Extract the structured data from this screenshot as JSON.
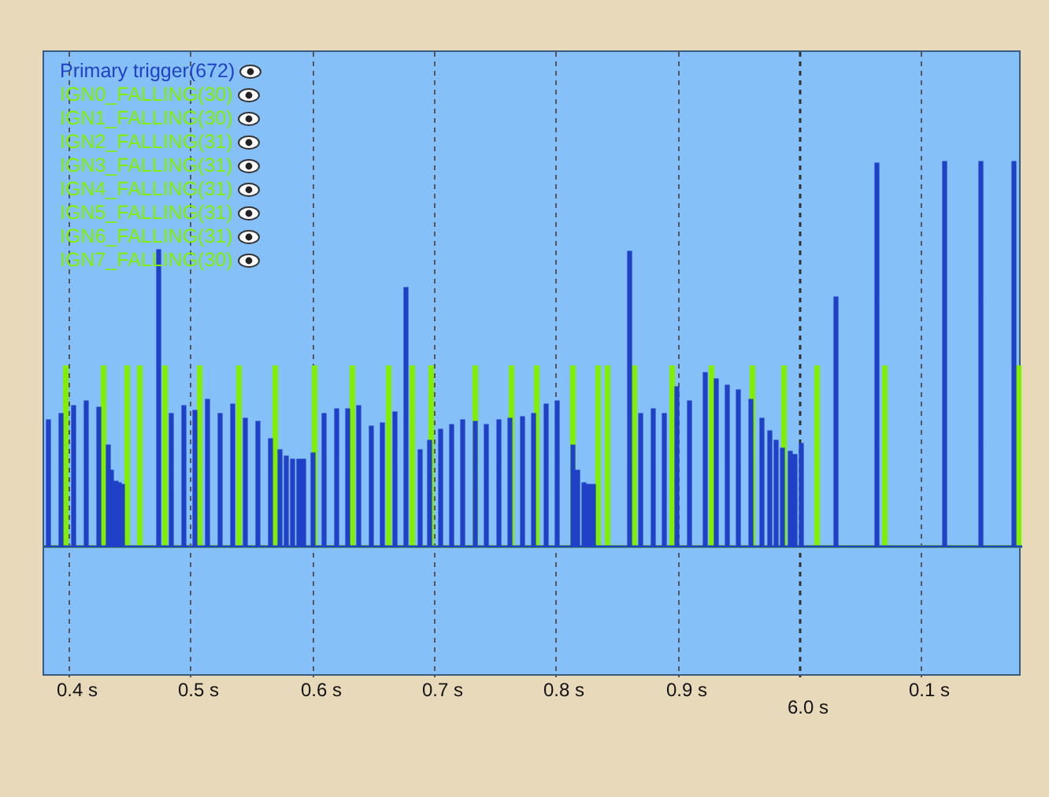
{
  "legend": [
    {
      "label": "Primary trigger(672)",
      "color": "#2040c8"
    },
    {
      "label": "IGN0_FALLING(30)",
      "color": "#80f000"
    },
    {
      "label": "IGN1_FALLING(30)",
      "color": "#80f000"
    },
    {
      "label": "IGN2_FALLING(31)",
      "color": "#80f000"
    },
    {
      "label": "IGN3_FALLING(31)",
      "color": "#80f000"
    },
    {
      "label": "IGN4_FALLING(31)",
      "color": "#80f000"
    },
    {
      "label": "IGN5_FALLING(31)",
      "color": "#80f000"
    },
    {
      "label": "IGN6_FALLING(31)",
      "color": "#80f000"
    },
    {
      "label": "IGN7_FALLING(30)",
      "color": "#80f000"
    }
  ],
  "x_ticks": [
    {
      "label": "0.4 s",
      "kind": "minor"
    },
    {
      "label": "0.5 s",
      "kind": "minor"
    },
    {
      "label": "0.6 s",
      "kind": "minor"
    },
    {
      "label": "0.7 s",
      "kind": "minor"
    },
    {
      "label": "0.8 s",
      "kind": "minor"
    },
    {
      "label": "0.9 s",
      "kind": "minor"
    },
    {
      "label": "6.0 s",
      "kind": "major"
    },
    {
      "label": "0.1 s",
      "kind": "minor"
    }
  ]
}
